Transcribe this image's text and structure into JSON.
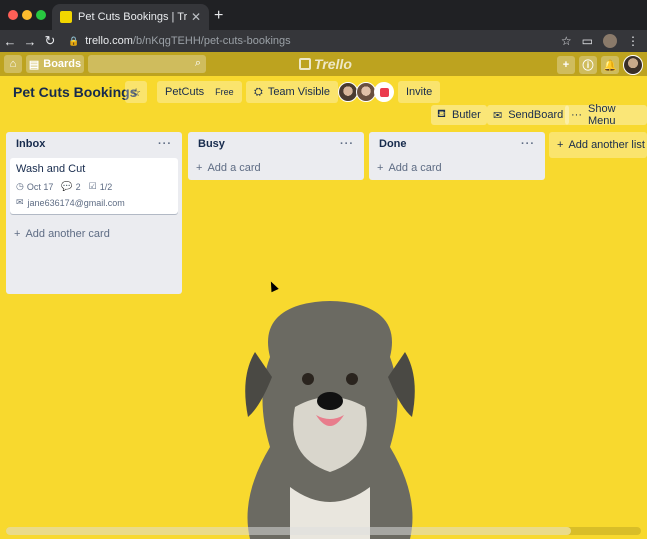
{
  "browser": {
    "tab_title": "Pet Cuts Bookings | Trello",
    "tab_close": "✕",
    "new_tab": "+",
    "url_host": "trello.com",
    "url_path": "/b/nKqgTEHH/pet-cuts-bookings"
  },
  "topbar": {
    "boards_label": "Boards",
    "logo_text": "Trello"
  },
  "board": {
    "title": "Pet Cuts Bookings",
    "team_name": "PetCuts",
    "team_plan": "Free",
    "visibility_label": "Team Visible",
    "invite_label": "Invite",
    "butler_label": "Butler",
    "sendboard_label": "SendBoard",
    "menu_label": "Show Menu",
    "add_list_label": "Add another list"
  },
  "lists": [
    {
      "title": "Inbox",
      "cards": [
        {
          "title": "Wash and Cut",
          "due": "Oct 17",
          "comments": "2",
          "checklist": "1/2",
          "email": "jane636174@gmail.com"
        }
      ],
      "add_label": "Add another card"
    },
    {
      "title": "Busy",
      "add_label": "Add a card"
    },
    {
      "title": "Done",
      "add_label": "Add a card"
    }
  ],
  "colors": {
    "board_background": "#f8d92e",
    "list_background": "#ebecf0"
  }
}
